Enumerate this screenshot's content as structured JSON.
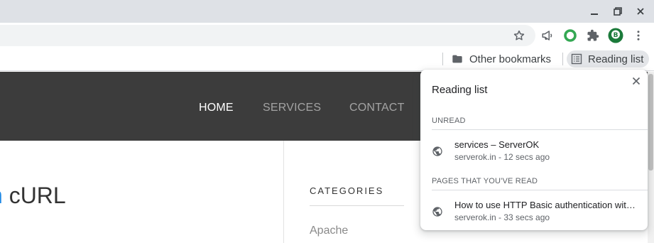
{
  "window": {
    "minimize_icon": "minimize-icon",
    "restore_icon": "restore-icon",
    "close_icon": "close-icon"
  },
  "toolbar": {
    "icons": [
      "star-icon",
      "megaphone-icon",
      "green-ring-icon",
      "puzzle-icon",
      "profile-avatar",
      "more-vert-icon"
    ]
  },
  "bookmarks": {
    "other_bookmarks": "Other bookmarks",
    "reading_list": "Reading list"
  },
  "page": {
    "nav": {
      "home": "HOME",
      "services": "SERVICES",
      "contact": "CONTACT"
    },
    "post_title_accent": "n",
    "post_title": " cURL",
    "sidebar": {
      "categories_heading": "CATEGORIES",
      "first_category": "Apache"
    }
  },
  "reading_list_panel": {
    "title": "Reading list",
    "unread_heading": "UNREAD",
    "read_heading": "PAGES THAT YOU'VE READ",
    "unread_items": [
      {
        "title": "services – ServerOK",
        "subtitle": "serverok.in - 12 secs ago"
      }
    ],
    "read_items": [
      {
        "title": "How to use HTTP Basic authentication with cURL",
        "subtitle": "serverok.in - 33 secs ago"
      }
    ]
  },
  "colors": {
    "titlebar": "#dee1e6",
    "nav_band": "#3c3c3c",
    "accent_link": "#1e88e5",
    "extension_green": "#34a853"
  }
}
